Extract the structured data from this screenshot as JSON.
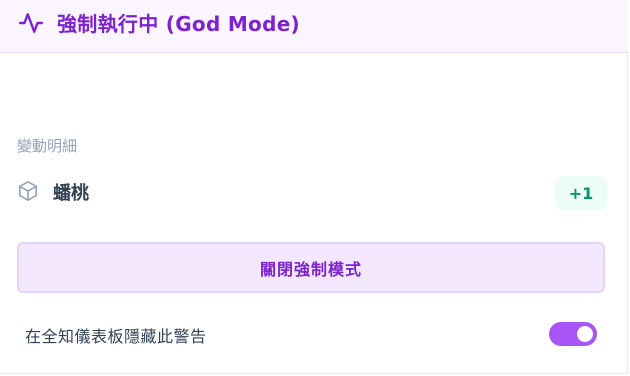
{
  "header": {
    "title": "強制執行中 (God Mode)",
    "icon": "activity-pulse-icon",
    "accent_color": "#7e22ce",
    "background_color": "#faf5ff"
  },
  "changes": {
    "section_label": "變動明細",
    "items": [
      {
        "icon": "cube-icon",
        "name": "蟠桃",
        "delta": "+1"
      }
    ]
  },
  "actions": {
    "disable_label": "關閉強制模式"
  },
  "settings": {
    "hide_warning_label": "在全知儀表板隱藏此警告",
    "hide_warning_enabled": true,
    "toggle_color": "#a855f7"
  }
}
